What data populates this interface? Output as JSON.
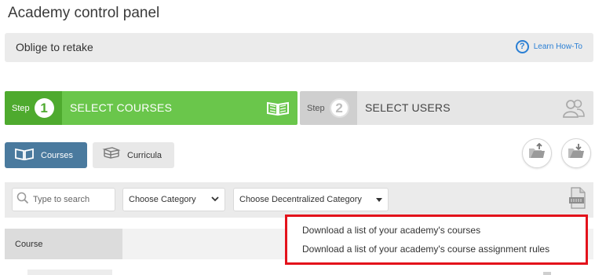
{
  "page": {
    "title": "Academy control panel"
  },
  "subheader": {
    "title": "Oblige to retake",
    "learn_label": "Learn How-To"
  },
  "steps": [
    {
      "word": "Step",
      "number": "1",
      "label": "SELECT COURSES",
      "state": "active",
      "color": "#6ac64b",
      "icon": "open-book-icon"
    },
    {
      "word": "Step",
      "number": "2",
      "label": "SELECT USERS",
      "state": "inactive",
      "color": "#e6e6e6",
      "icon": "users-icon"
    }
  ],
  "tabs": [
    {
      "label": "Courses",
      "active": true,
      "icon": "open-book-icon",
      "color": "#4a7a9e"
    },
    {
      "label": "Curricula",
      "active": false,
      "icon": "books-stack-icon"
    }
  ],
  "actions": [
    {
      "icon": "upload-folder-icon"
    },
    {
      "icon": "download-folder-icon"
    }
  ],
  "filters": {
    "search_placeholder": "Type to search",
    "category_value": "Choose Category",
    "decentralized_value": "Choose Decentralized Category",
    "export_icon": "csv-file-icon"
  },
  "table": {
    "columns": [
      "Course"
    ]
  },
  "dropdown": {
    "highlight_color": "#e3121b",
    "items": [
      "Download a list of your academy's courses",
      "Download a list of your academy's course assignment rules"
    ]
  }
}
